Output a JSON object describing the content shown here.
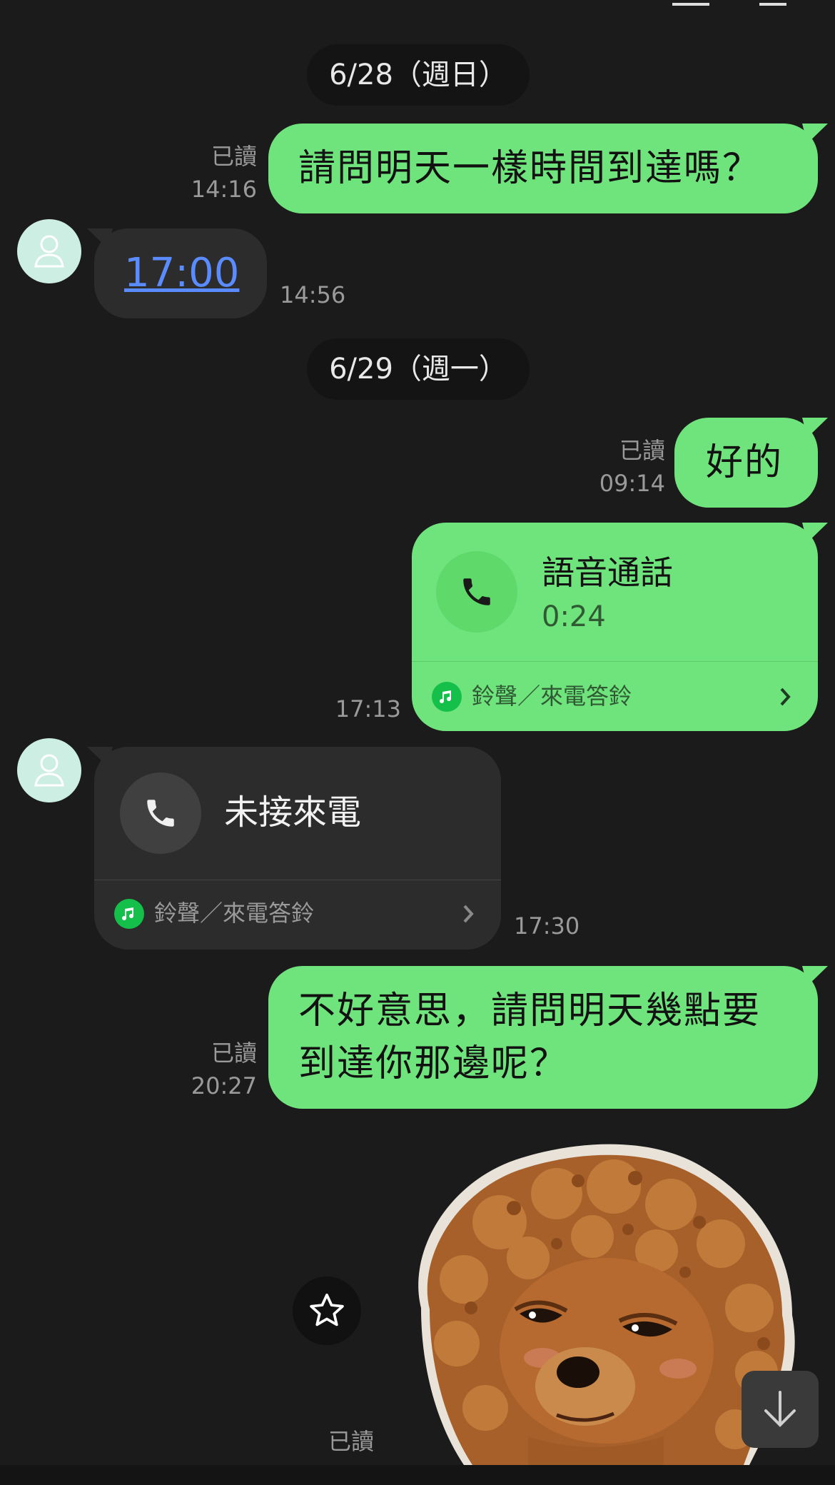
{
  "dates": {
    "first": "6/28（週日）",
    "second": "6/29（週一）"
  },
  "messages": {
    "m1": {
      "text": "請問明天一樣時間到達嗎？",
      "read": "已讀",
      "time": "14:16"
    },
    "m2": {
      "text": "17:00",
      "time": "14:56"
    },
    "m3": {
      "text": "好的",
      "read": "已讀",
      "time": "09:14"
    },
    "m4": {
      "title": "語音通話",
      "duration": "0:24",
      "ringtone": "鈴聲／來電答鈴",
      "time": "17:13"
    },
    "m5": {
      "title": "未接來電",
      "ringtone": "鈴聲／來電答鈴",
      "time": "17:30"
    },
    "m6": {
      "line1": "不好意思，請問明天幾點要",
      "line2": "到達你那邊呢？",
      "read": "已讀",
      "time": "20:27"
    },
    "m7": {
      "read": "已讀"
    }
  },
  "colors": {
    "sent_bubble": "#6fe37c",
    "received_bubble": "#2c2c2c",
    "background": "#1b1b1b",
    "link": "#5b8cff"
  },
  "icons": [
    "phone-icon",
    "music-note-icon",
    "chevron-right-icon",
    "user-icon",
    "star-icon",
    "arrow-down-icon"
  ]
}
